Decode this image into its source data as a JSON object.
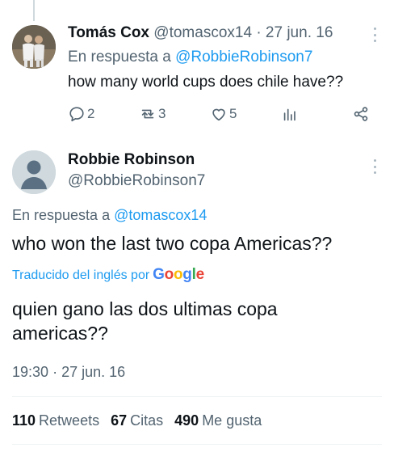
{
  "parent_tweet": {
    "author_name": "Tomás Cox",
    "author_handle": "@tomascox14",
    "separator": "·",
    "date": "27 jun. 16",
    "reply_prefix": "En respuesta a",
    "reply_to": "@RobbieRobinson7",
    "text": "how many world cups does chile have??",
    "actions": {
      "replies": "2",
      "retweets": "3",
      "likes": "5"
    }
  },
  "main_tweet": {
    "author_name": "Robbie Robinson",
    "author_handle": "@RobbieRobinson7",
    "reply_prefix": "En respuesta a",
    "reply_to": "@tomascox14",
    "text": "who won the last two copa Americas??",
    "translated_label": "Traducido del inglés por",
    "translator": "Google",
    "translation": "quien gano las dos ultimas copa americas??",
    "time": "19:30",
    "separator": "·",
    "date": "27 jun. 16",
    "stats": {
      "retweets_count": "110",
      "retweets_label": "Retweets",
      "quotes_count": "67",
      "quotes_label": "Citas",
      "likes_count": "490",
      "likes_label": "Me gusta"
    }
  },
  "colors": {
    "link": "#1d9bf0",
    "muted": "#536471",
    "text": "#0f1419",
    "divider": "#eff3f4",
    "google_blue": "#4285f4",
    "google_red": "#ea4335",
    "google_yellow": "#fbbc05",
    "google_green": "#34a853"
  },
  "icons": [
    "reply-icon",
    "retweet-icon",
    "like-icon",
    "analytics-icon",
    "share-icon",
    "more-options-icon"
  ]
}
